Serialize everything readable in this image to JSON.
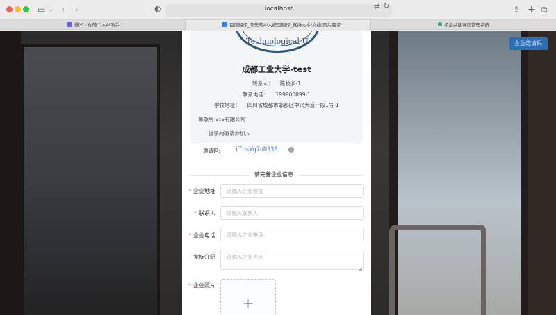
{
  "browser": {
    "address": "localhost",
    "tabs": [
      {
        "label": "通义 - 你的个人AI助手",
        "color": "#6b5cf0"
      },
      {
        "label": "百度翻译_领先的AI大模型翻译_支持文本/文档/图片翻译",
        "color": "#3d7ff0"
      },
      {
        "label": "校企共建课程管理系统",
        "color": "#4aa87a"
      }
    ]
  },
  "page": {
    "invite_button": "企业邀请码",
    "seal_text": "Technological U",
    "school_name": "成都工业大学-test",
    "contact_label": "联系人：",
    "contact_value": "陈校长-1",
    "phone_label": "联系电话：",
    "phone_value": "199900099-1",
    "address_label": "学校地址：",
    "address_value": "四川省成都市郫都区中兴大道一段1号-1",
    "greeting": "尊敬的 xxx有限公司：",
    "sub_greeting": "诚挚的邀请你加入",
    "code_label": "邀请码:",
    "code_value": "iTnsWq7oD538",
    "section_title": "请完善企业信息"
  },
  "form": {
    "address": {
      "label": "企业地址",
      "placeholder": "请输入企业地址",
      "required": true
    },
    "contact": {
      "label": "联系人",
      "placeholder": "请输入联系人",
      "required": true
    },
    "phone": {
      "label": "企业电话",
      "placeholder": "请输入企业电话",
      "required": true
    },
    "intro": {
      "label": "竞标介绍",
      "placeholder": "请输入企业亮点",
      "required": false
    },
    "photo": {
      "label": "企业照片",
      "required": true
    }
  },
  "colors": {
    "accent": "#2d6db4",
    "link": "#3a7bd5",
    "required": "#f56c6c"
  }
}
